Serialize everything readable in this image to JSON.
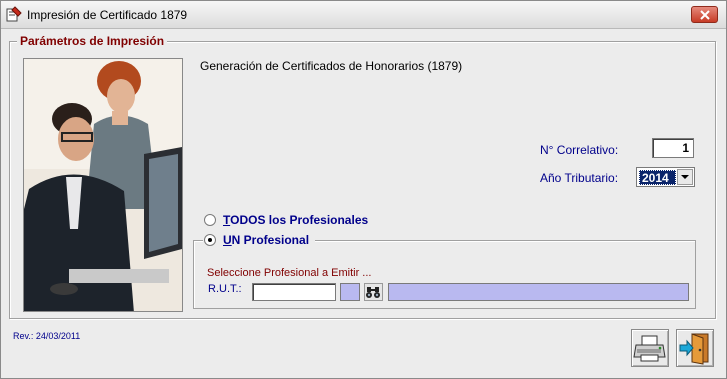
{
  "window": {
    "title": "Impresión de Certificado 1879"
  },
  "group": {
    "legend": "Parámetros de Impresión",
    "description": "Generación de Certificados de Honorarios (1879)"
  },
  "fields": {
    "correlativo_label": "N° Correlativo:",
    "correlativo_value": "1",
    "anio_label": "Año Tributario:",
    "anio_value": "2014"
  },
  "options": {
    "todos_first": "T",
    "todos_rest": "ODOS los Profesionales",
    "todos_selected": false,
    "uno_first": "U",
    "uno_rest": "N Profesional",
    "uno_selected": true
  },
  "profesional": {
    "select_label": "Seleccione Profesional a Emitir ...",
    "rut_label": "R.U.T.:",
    "rut_value": "",
    "dv_value": "",
    "nombre_value": ""
  },
  "footer": {
    "revision": "Rev.: 24/03/2011"
  },
  "icons": {
    "app": "certificate-app-icon",
    "close": "close-icon",
    "search": "binoculars-icon",
    "print": "printer-icon",
    "exit": "exit-door-icon"
  },
  "colors": {
    "legend": "#800000",
    "label_blue": "#00008b",
    "readonly_field": "#b9b9f0",
    "selection": "#0a246a"
  }
}
